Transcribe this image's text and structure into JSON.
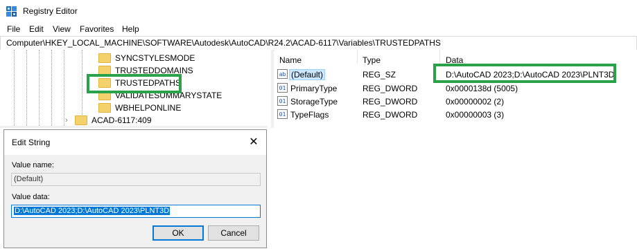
{
  "window": {
    "title": "Registry Editor",
    "icon": "registry-icon",
    "accent": "#2aa24a"
  },
  "menu": [
    "File",
    "Edit",
    "View",
    "Favorites",
    "Help"
  ],
  "address": "Computer\\HKEY_LOCAL_MACHINE\\SOFTWARE\\Autodesk\\AutoCAD\\R24.2\\ACAD-6117\\Variables\\TRUSTEDPATHS",
  "tree": {
    "items": [
      {
        "label": "SYNCSTYLESMODE"
      },
      {
        "label": "TRUSTEDDOMAINS"
      },
      {
        "label": "TRUSTEDPATHS",
        "selected": true
      },
      {
        "label": "VALIDATESUMMARYSTATE"
      },
      {
        "label": "WBHELPONLINE"
      },
      {
        "label": "ACAD-6117:409",
        "expandable": true
      }
    ]
  },
  "list": {
    "columns": [
      "Name",
      "Type",
      "Data"
    ],
    "rows": [
      {
        "icon": "string-value-icon",
        "name": "(Default)",
        "type": "REG_SZ",
        "data": "D:\\AutoCAD 2023;D:\\AutoCAD 2023\\PLNT3D",
        "selected": true
      },
      {
        "icon": "dword-value-icon",
        "name": "PrimaryType",
        "type": "REG_DWORD",
        "data": "0x0000138d (5005)"
      },
      {
        "icon": "dword-value-icon",
        "name": "StorageType",
        "type": "REG_DWORD",
        "data": "0x00000002 (2)"
      },
      {
        "icon": "dword-value-icon",
        "name": "TypeFlags",
        "type": "REG_DWORD",
        "data": "0x00000003 (3)"
      }
    ]
  },
  "dialog": {
    "title": "Edit String",
    "close_glyph": "✕",
    "value_name_label": "Value name:",
    "value_name": "(Default)",
    "value_data_label": "Value data:",
    "value_data": "D:\\AutoCAD 2023;D:\\AutoCAD 2023\\PLNT3D",
    "ok_label": "OK",
    "cancel_label": "Cancel"
  }
}
